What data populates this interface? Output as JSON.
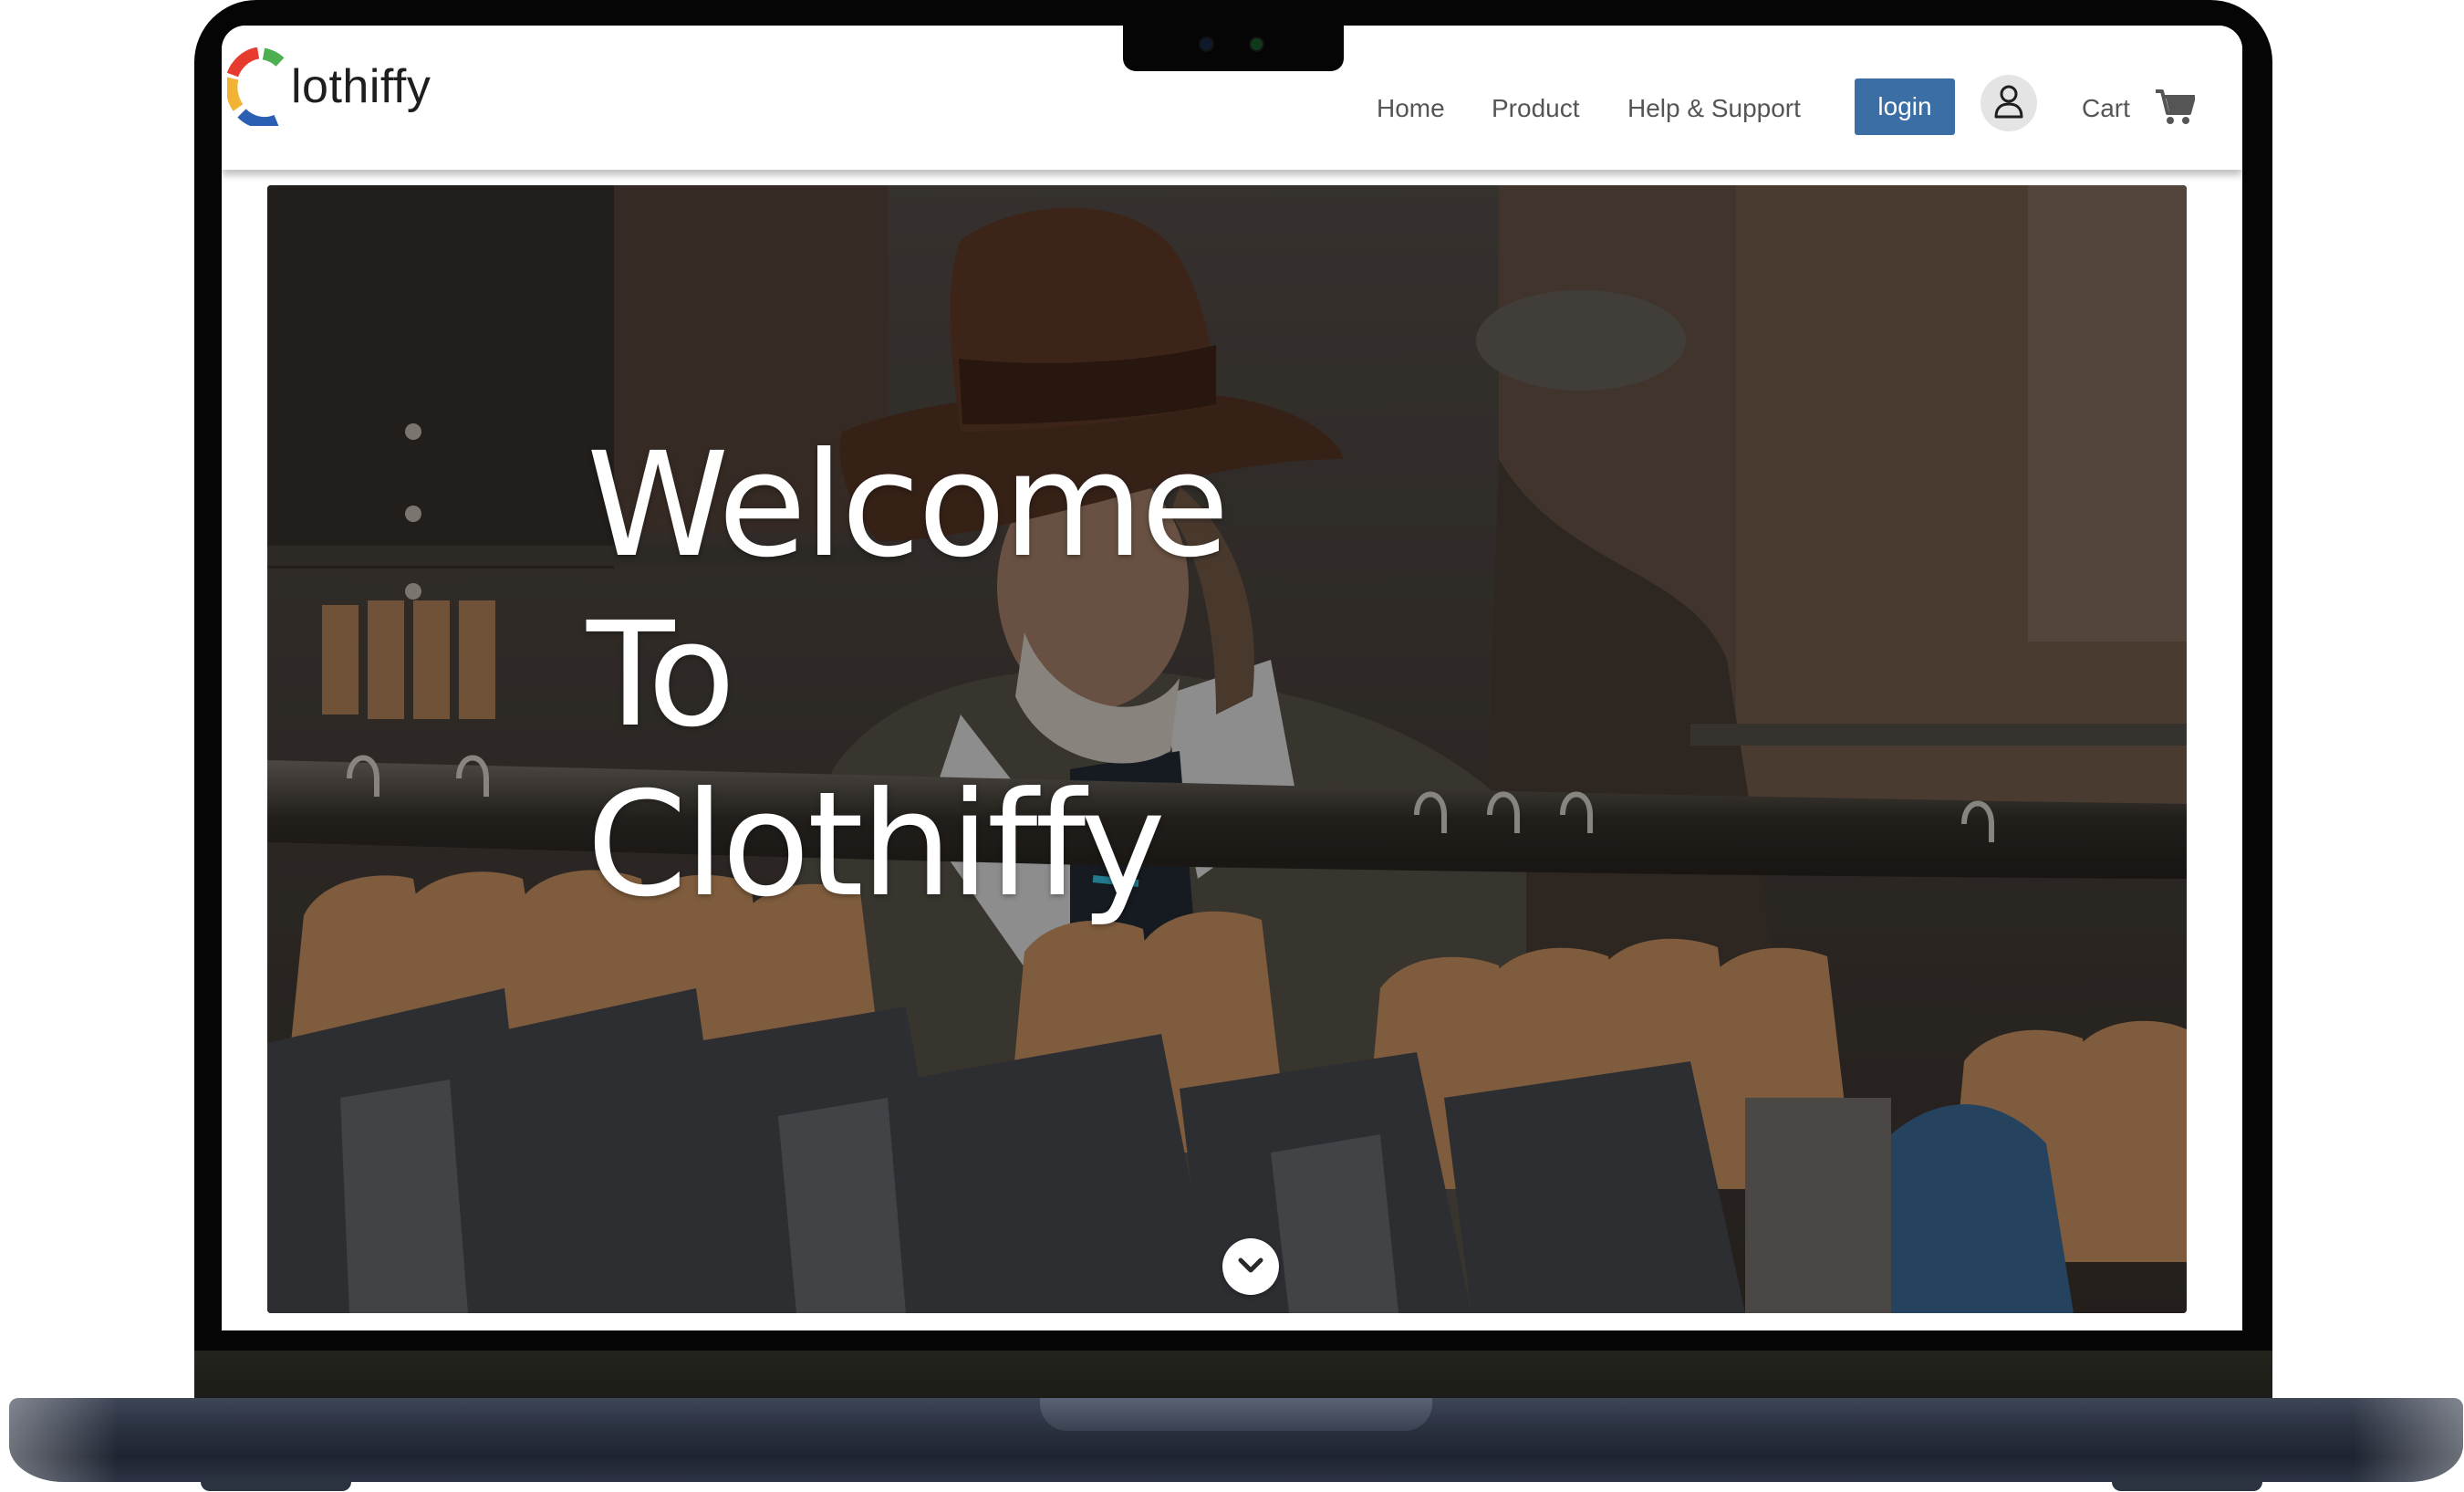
{
  "brand": {
    "logo_text": "lothiffy",
    "logo_colors": [
      "#e63b2e",
      "#4caf50",
      "#f2b233",
      "#2b5fb4"
    ]
  },
  "nav": {
    "home": "Home",
    "product": "Product",
    "help": "Help & Support",
    "login": "login",
    "cart": "Cart",
    "accent_color": "#3a6ea5"
  },
  "hero": {
    "title_line_1": "Welcome",
    "title_line_2": "To",
    "title_line_3": "Clothiffy",
    "scroll_icon": "chevron-down-icon"
  }
}
